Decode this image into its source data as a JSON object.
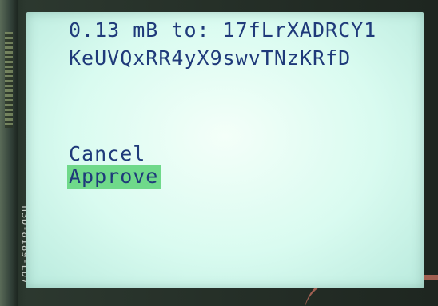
{
  "device": {
    "module_label": "HSD-8189-LD7"
  },
  "screen": {
    "line1": "0.13 mB to: 17fLrXADRCY1",
    "line2": "KeUVQxRR4yX9swvTNzKRfD",
    "menu": {
      "cancel": "Cancel",
      "approve": "Approve"
    }
  },
  "colors": {
    "text": "#1f3a7a",
    "screen_bg": "#e6fff6",
    "highlight": "#6fd98a"
  }
}
